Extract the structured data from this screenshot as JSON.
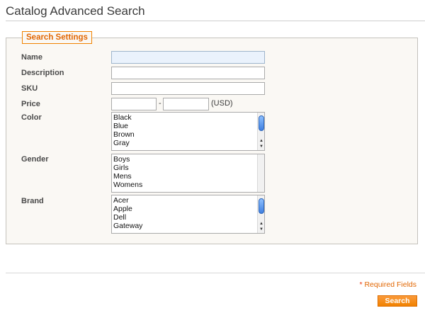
{
  "page": {
    "title": "Catalog Advanced Search"
  },
  "form": {
    "legend": "Search Settings",
    "name": {
      "label": "Name",
      "value": ""
    },
    "description": {
      "label": "Description",
      "value": ""
    },
    "sku": {
      "label": "SKU",
      "value": ""
    },
    "price": {
      "label": "Price",
      "from": "",
      "to": "",
      "separator": "-",
      "currency": "(USD)"
    },
    "color": {
      "label": "Color",
      "options": [
        "Black",
        "Blue",
        "Brown",
        "Gray"
      ]
    },
    "gender": {
      "label": "Gender",
      "options": [
        "Boys",
        "Girls",
        "Mens",
        "Womens"
      ]
    },
    "brand": {
      "label": "Brand",
      "options": [
        "Acer",
        "Apple",
        "Dell",
        "Gateway"
      ]
    }
  },
  "footer": {
    "required_star": "*",
    "required_text": "Required Fields",
    "search_label": "Search"
  },
  "colors": {
    "accent": "#f18200",
    "legend_text": "#e26703",
    "focus_bg": "#eaf2fc"
  },
  "icons": {
    "scroll_up": "triangle-up-icon",
    "scroll_down": "triangle-down-icon"
  }
}
